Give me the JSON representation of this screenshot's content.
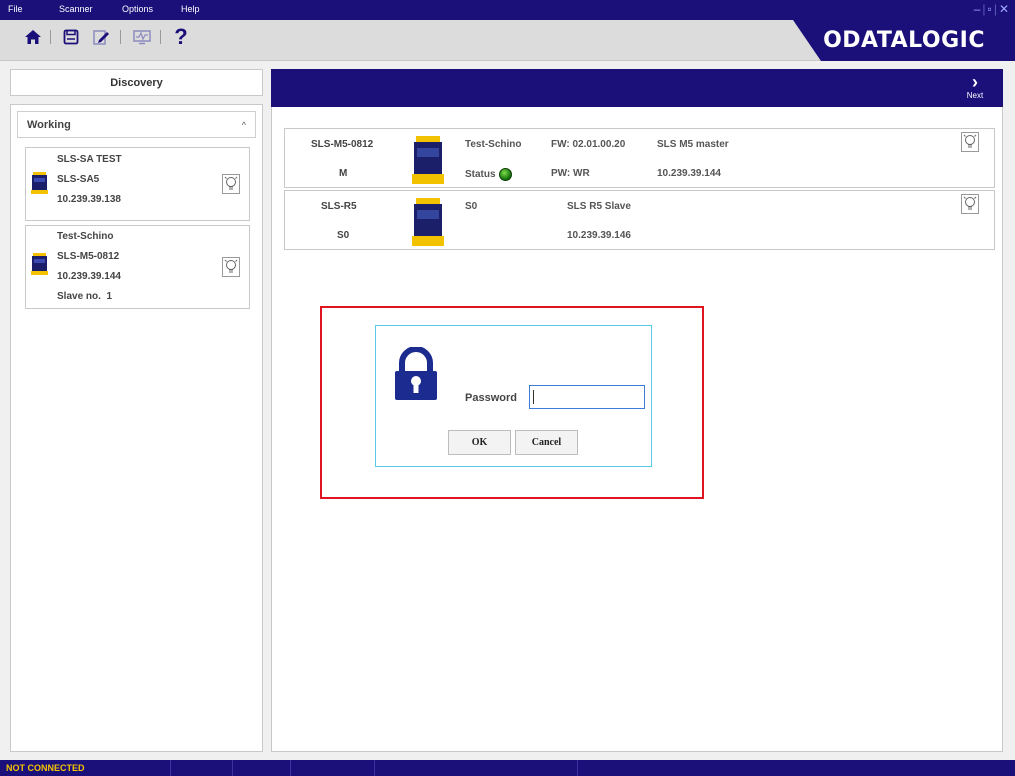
{
  "menu": {
    "items": [
      "File",
      "Scanner",
      "Options",
      "Help"
    ]
  },
  "window_controls": [
    "minimize-icon",
    "restore-icon",
    "close-icon"
  ],
  "toolbar": {
    "icons": [
      "home-icon",
      "save-icon",
      "edit-document-icon",
      "monitor-icon",
      "help-icon"
    ],
    "help_label": "?"
  },
  "brand": {
    "logo_text": "ODATALOGIC"
  },
  "colors": {
    "brand_navy": "#1b0f7a",
    "status_yellow": "#f5c400",
    "highlight_red": "#e0141e",
    "dialog_border": "#5cc8e6",
    "status_green": "#1e7d12"
  },
  "sidebar": {
    "discovery_label": "Discovery",
    "group_label": "Working",
    "group_caret": "^",
    "devices": [
      {
        "title": "SLS-SA TEST",
        "model": "SLS-SA5",
        "ip": "10.239.39.138",
        "extra": ""
      },
      {
        "title": "Test-Schino",
        "model": "SLS-M5-0812",
        "ip": "10.239.39.144",
        "extra": "Slave no.  1"
      }
    ]
  },
  "main": {
    "next_label": "Next",
    "next_arrow": "›",
    "devices": [
      {
        "name": "SLS-M5-0812",
        "role": "M",
        "group": "Test-Schino",
        "status_label": "Status",
        "fw": "FW: 02.01.00.20",
        "pw": "PW: WR",
        "type": "SLS M5 master",
        "ip": "10.239.39.144"
      },
      {
        "name": "SLS-R5",
        "role": "S0",
        "group": "S0",
        "type": "SLS R5 Slave",
        "ip": "10.239.39.146"
      }
    ]
  },
  "password_dialog": {
    "label": "Password",
    "value": "",
    "ok_label": "OK",
    "cancel_label": "Cancel"
  },
  "statusbar": {
    "text": "NOT CONNECTED"
  }
}
